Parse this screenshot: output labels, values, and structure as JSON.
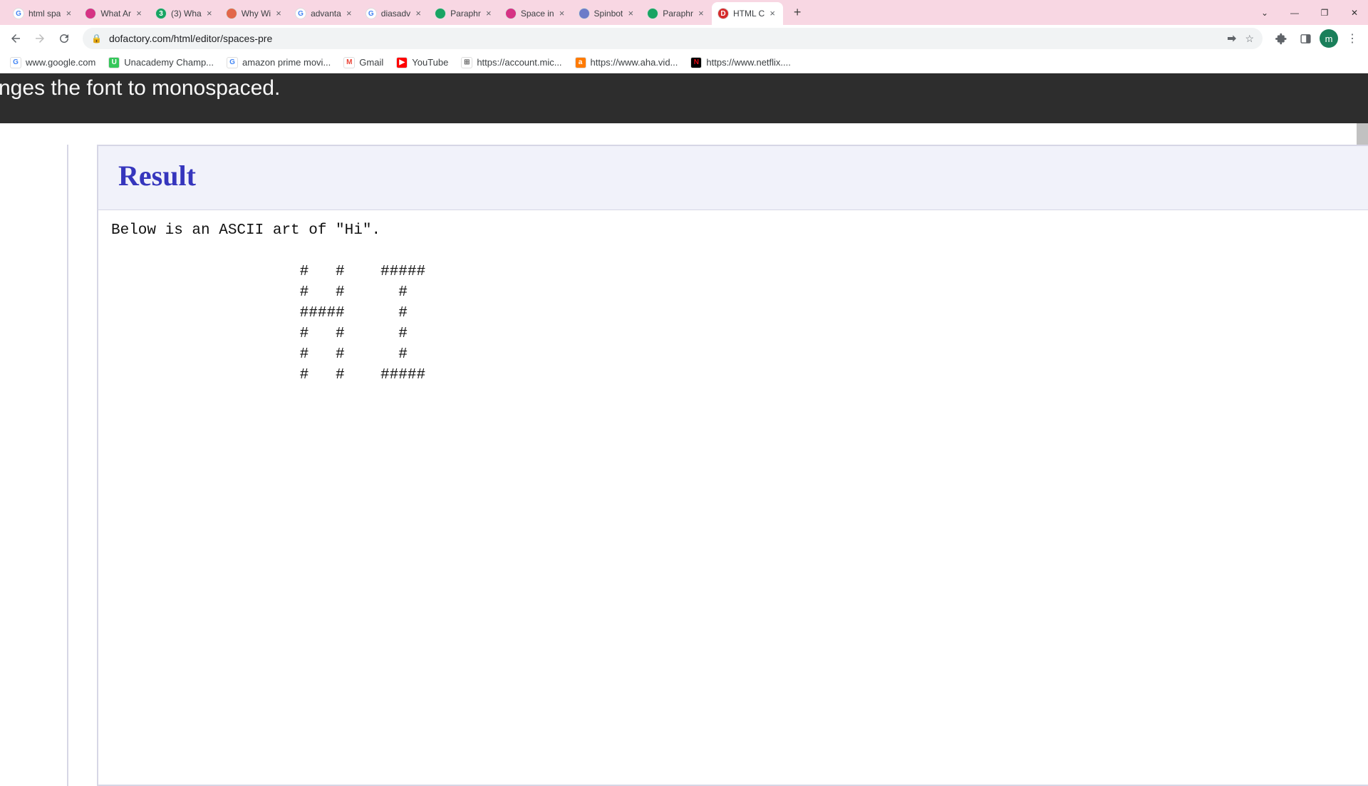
{
  "tabs": [
    {
      "title": "html spa",
      "icon_bg": "#fff",
      "icon_text": "G",
      "icon_color": "#4285f4"
    },
    {
      "title": "What Ar",
      "icon_bg": "#d63384",
      "icon_text": ""
    },
    {
      "title": "(3) Wha",
      "icon_bg": "#19a463",
      "icon_text": "3"
    },
    {
      "title": "Why Wi",
      "icon_bg": "#e2674a",
      "icon_text": ""
    },
    {
      "title": "advanta",
      "icon_bg": "#fff",
      "icon_text": "G",
      "icon_color": "#4285f4"
    },
    {
      "title": "diasadv",
      "icon_bg": "#fff",
      "icon_text": "G",
      "icon_color": "#4285f4"
    },
    {
      "title": "Paraphr",
      "icon_bg": "#19a463",
      "icon_text": ""
    },
    {
      "title": "Space in",
      "icon_bg": "#d63384",
      "icon_text": ""
    },
    {
      "title": "Spinbot",
      "icon_bg": "#6b7cc9",
      "icon_text": ""
    },
    {
      "title": "Paraphr",
      "icon_bg": "#19a463",
      "icon_text": ""
    },
    {
      "title": "HTML C",
      "icon_bg": "#d52b2b",
      "icon_text": "D"
    }
  ],
  "active_tab_index": 10,
  "url": "dofactory.com/html/editor/spaces-pre",
  "bookmarks": [
    {
      "label": "www.google.com",
      "icon_bg": "#fff",
      "icon_text": "G",
      "icon_color": "#4285f4"
    },
    {
      "label": "Unacademy Champ...",
      "icon_bg": "#34c759",
      "icon_text": "U"
    },
    {
      "label": "amazon prime movi...",
      "icon_bg": "#fff",
      "icon_text": "G",
      "icon_color": "#4285f4"
    },
    {
      "label": "Gmail",
      "icon_bg": "#fff",
      "icon_text": "M",
      "icon_color": "#ea4335"
    },
    {
      "label": "YouTube",
      "icon_bg": "#ff0000",
      "icon_text": "▶"
    },
    {
      "label": "https://account.mic...",
      "icon_bg": "#fff",
      "icon_text": "⊞",
      "icon_color": "#666"
    },
    {
      "label": "https://www.aha.vid...",
      "icon_bg": "#ff7a00",
      "icon_text": "a"
    },
    {
      "label": "https://www.netflix....",
      "icon_bg": "#000",
      "icon_text": "N",
      "icon_color": "#e50914"
    }
  ],
  "banner_text": "nges the font to monospaced.",
  "result": {
    "heading": "Result",
    "pre": "Below is an ASCII art of \"Hi\".\n\n                     #   #    #####\n                     #   #      #\n                     #####      #\n                     #   #      #\n                     #   #      #\n                     #   #    #####"
  },
  "avatar_letter": "m"
}
